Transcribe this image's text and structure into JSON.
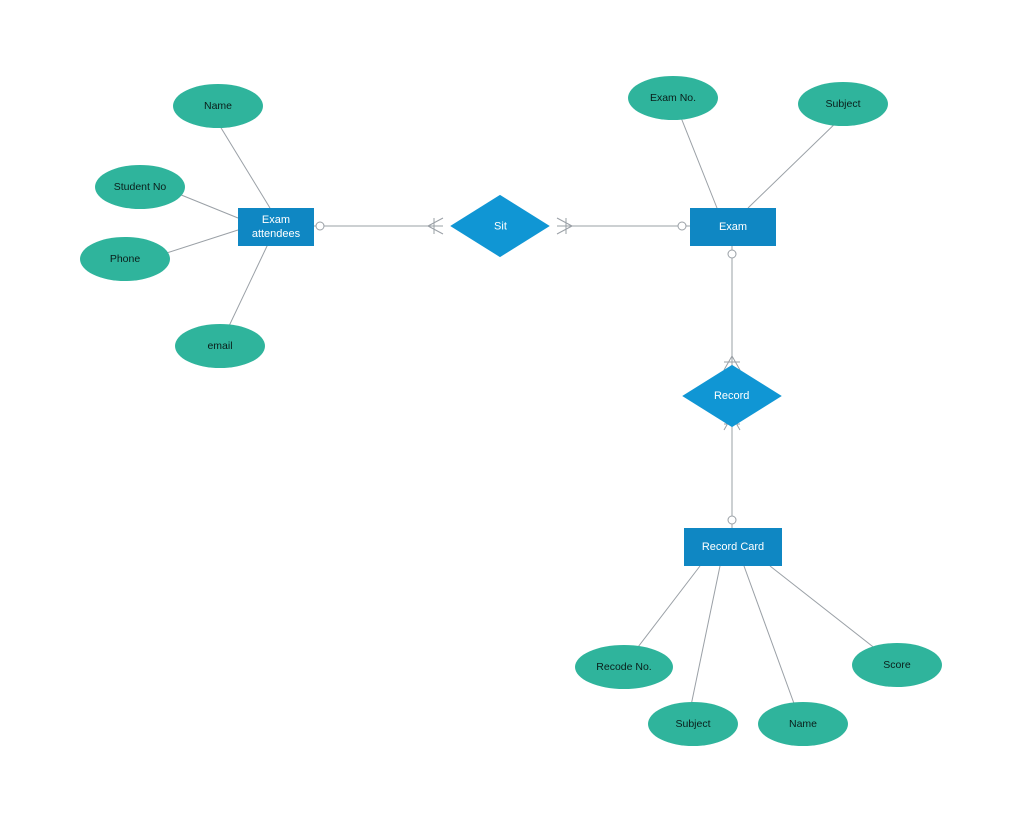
{
  "entities": {
    "exam_attendees": "Exam\nattendees",
    "exam": "Exam",
    "record_card": "Record Card"
  },
  "relationships": {
    "sit": "Sit",
    "record": "Record"
  },
  "attributes": {
    "name": "Name",
    "student_no": "Student No",
    "phone": "Phone",
    "email": "email",
    "exam_no": "Exam No.",
    "subject": "Subject",
    "recode_no": "Recode No.",
    "rc_subject": "Subject",
    "rc_name": "Name",
    "score": "Score"
  }
}
